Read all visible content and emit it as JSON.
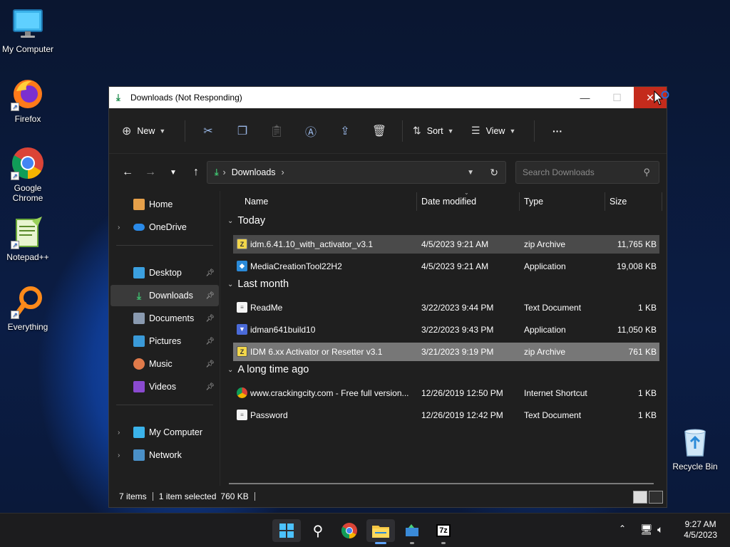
{
  "desktop": {
    "icons": [
      {
        "label": "My Computer",
        "icon": "monitor-icon"
      },
      {
        "label": "Firefox",
        "icon": "firefox-icon"
      },
      {
        "label": "Google\nChrome",
        "icon": "chrome-icon"
      },
      {
        "label": "Notepad++",
        "icon": "notepadpp-icon"
      },
      {
        "label": "Everything",
        "icon": "everything-search-icon"
      },
      {
        "label": "Recycle Bin",
        "icon": "recycle-bin-icon"
      }
    ]
  },
  "window": {
    "title": "Downloads (Not Responding)",
    "controls": {
      "minimize": "—",
      "maximize": "☐",
      "close": "✕"
    }
  },
  "toolbar": {
    "new_label": "New",
    "sort_label": "Sort",
    "view_label": "View",
    "more_label": "···"
  },
  "address": {
    "path": "Downloads",
    "search_placeholder": "Search Downloads"
  },
  "sidebar": {
    "items": [
      {
        "label": "Home",
        "icon": "home-icon"
      },
      {
        "label": "OneDrive",
        "icon": "cloud-icon"
      },
      {
        "label": "Desktop",
        "icon": "desktop-folder-icon"
      },
      {
        "label": "Downloads",
        "icon": "downloads-folder-icon"
      },
      {
        "label": "Documents",
        "icon": "documents-folder-icon"
      },
      {
        "label": "Pictures",
        "icon": "pictures-folder-icon"
      },
      {
        "label": "Music",
        "icon": "music-folder-icon"
      },
      {
        "label": "Videos",
        "icon": "videos-folder-icon"
      },
      {
        "label": "My Computer",
        "icon": "computer-icon"
      },
      {
        "label": "Network",
        "icon": "network-icon"
      }
    ]
  },
  "columns": {
    "name": "Name",
    "date": "Date modified",
    "type": "Type",
    "size": "Size"
  },
  "groups": [
    {
      "label": "Today",
      "files": [
        {
          "name": "idm.6.41.10_with_activator_v3.1",
          "date": "4/5/2023 9:21 AM",
          "type": "zip Archive",
          "size": "11,765 KB",
          "icon": "zip-icon"
        },
        {
          "name": "MediaCreationTool22H2",
          "date": "4/5/2023 9:21 AM",
          "type": "Application",
          "size": "19,008 KB",
          "icon": "app-icon"
        }
      ]
    },
    {
      "label": "Last month",
      "files": [
        {
          "name": "ReadMe",
          "date": "3/22/2023 9:44 PM",
          "type": "Text Document",
          "size": "1 KB",
          "icon": "text-file-icon"
        },
        {
          "name": "idman641build10",
          "date": "3/22/2023 9:43 PM",
          "type": "Application",
          "size": "11,050 KB",
          "icon": "installer-icon"
        },
        {
          "name": "IDM 6.xx Activator or Resetter v3.1",
          "date": "3/21/2023 9:19 PM",
          "type": "zip Archive",
          "size": "761 KB",
          "icon": "zip-icon"
        }
      ]
    },
    {
      "label": "A long time ago",
      "files": [
        {
          "name": "www.crackingcity.com - Free full version...",
          "date": "12/26/2019 12:50 PM",
          "type": "Internet Shortcut",
          "size": "1 KB",
          "icon": "chrome-shortcut-icon"
        },
        {
          "name": "Password",
          "date": "12/26/2019 12:42 PM",
          "type": "Text Document",
          "size": "1 KB",
          "icon": "text-file-icon"
        }
      ]
    }
  ],
  "status": {
    "items": "7 items",
    "selected": "1 item selected",
    "size": "760 KB"
  },
  "taskbar": {
    "time": "9:27 AM",
    "date": "4/5/2023",
    "apps": [
      "start-icon",
      "search-icon",
      "chrome-icon",
      "file-explorer-icon",
      "app-icon",
      "7zip-icon"
    ],
    "zip_label": "7z"
  },
  "colors": {
    "close_red": "#c42b1c",
    "accent_green": "#3fbf6f",
    "taskbar_accent": "#60a5fa"
  }
}
